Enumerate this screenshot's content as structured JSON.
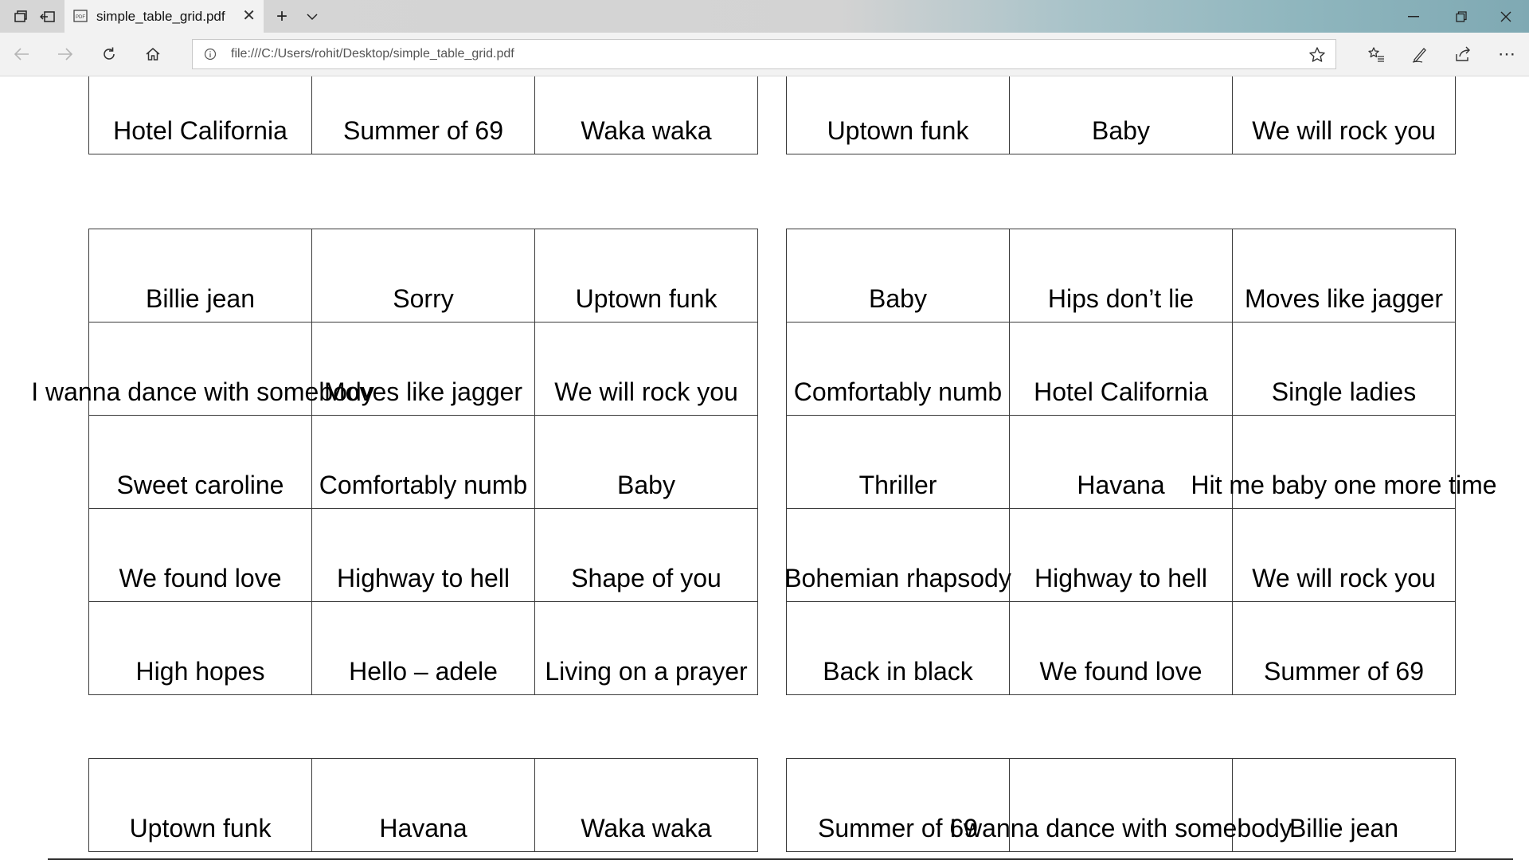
{
  "browser": {
    "tab_title": "simple_table_grid.pdf",
    "url": "file:///C:/Users/rohit/Desktop/simple_table_grid.pdf",
    "icons": {
      "tab_actions": "tab-actions-icon",
      "set_aside": "set-aside-tabs-icon",
      "pdf": "pdf-icon",
      "close_tab": "close-icon",
      "new_tab": "plus-icon",
      "tab_preview": "chevron-down-icon",
      "minimize": "minimize-icon",
      "restore": "restore-icon",
      "close_window": "close-icon",
      "back": "back-arrow-icon",
      "forward": "forward-arrow-icon",
      "refresh": "refresh-icon",
      "home": "home-icon",
      "info": "info-icon",
      "favorite": "star-icon",
      "favorites_hub": "favorites-list-icon",
      "notes": "pen-icon",
      "share": "share-icon",
      "more": "more-icon"
    }
  },
  "document": {
    "tables": [
      {
        "rows": [
          [
            "Hotel California",
            "Summer of 69",
            "Waka waka"
          ]
        ]
      },
      {
        "rows": [
          [
            "Uptown funk",
            "Baby",
            "We will rock you"
          ]
        ]
      },
      {
        "rows": [
          [
            "Billie jean",
            "Sorry",
            "Uptown funk"
          ],
          [
            "I wanna dance with somebody",
            "Moves like jagger",
            "We will rock you"
          ],
          [
            "Sweet caroline",
            "Comfortably numb",
            "Baby"
          ],
          [
            "We found love",
            "Highway to hell",
            "Shape of you"
          ],
          [
            "High hopes",
            "Hello – adele",
            "Living on a prayer"
          ]
        ]
      },
      {
        "rows": [
          [
            "Baby",
            "Hips don’t lie",
            "Moves like jagger"
          ],
          [
            "Comfortably numb",
            "Hotel California",
            "Single ladies"
          ],
          [
            "Thriller",
            "Havana",
            "Hit me baby one more time"
          ],
          [
            "Bohemian rhapsody",
            "Highway to hell",
            "We will rock you"
          ],
          [
            "Back in black",
            "We found love",
            "Summer of 69"
          ]
        ]
      },
      {
        "rows": [
          [
            "Uptown funk",
            "Havana",
            "Waka waka"
          ]
        ]
      },
      {
        "rows": [
          [
            "Summer of 69",
            "I wanna dance with somebody",
            "Billie jean"
          ]
        ]
      }
    ]
  }
}
